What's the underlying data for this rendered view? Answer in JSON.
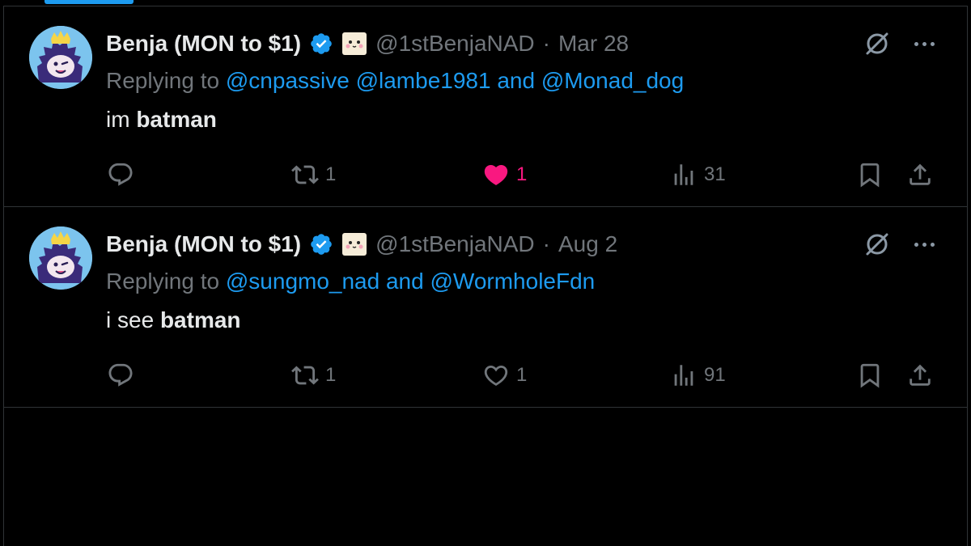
{
  "tweets": [
    {
      "author_name": "Benja (MON to $1)",
      "handle": "@1stBenjaNAD",
      "separator": "·",
      "date": "Mar 28",
      "replying_prefix": "Replying to",
      "mentions": [
        "@cnpassive",
        "@lambe1981"
      ],
      "and_word": "and",
      "last_mention": "@Monad_dog",
      "text_plain": "im",
      "text_bold": "batman",
      "reply_count": "",
      "retweet_count": "1",
      "like_count": "1",
      "liked": true,
      "view_count": "31"
    },
    {
      "author_name": "Benja (MON to $1)",
      "handle": "@1stBenjaNAD",
      "separator": "·",
      "date": "Aug 2",
      "replying_prefix": "Replying to",
      "mentions": [
        "@sungmo_nad"
      ],
      "and_word": "and",
      "last_mention": "@WormholeFdn",
      "text_plain": "i see",
      "text_bold": "batman",
      "reply_count": "",
      "retweet_count": "1",
      "like_count": "1",
      "liked": false,
      "view_count": "91"
    }
  ],
  "colors": {
    "background": "#000000",
    "text": "#e7e9ea",
    "muted": "#71767b",
    "link": "#1d9bf0",
    "like_active": "#f91880",
    "border": "#2f3336"
  },
  "icons": [
    "verified-badge-icon",
    "emoji-face-icon",
    "grok-icon",
    "more-icon",
    "reply-icon",
    "retweet-icon",
    "heart-icon",
    "views-icon",
    "bookmark-icon",
    "share-icon"
  ]
}
